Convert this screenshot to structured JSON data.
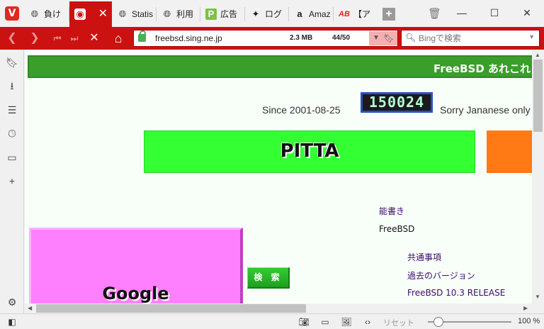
{
  "browser": {
    "tabs": [
      {
        "label": "負け",
        "icon": "globe"
      },
      {
        "label": "",
        "icon": "vivaldi-red"
      },
      {
        "label": "Statis",
        "icon": "globe"
      },
      {
        "label": "利用",
        "icon": "globe"
      },
      {
        "label": "広告",
        "icon": "p-green"
      },
      {
        "label": "ログ",
        "icon": "star-black"
      },
      {
        "label": "Amaz",
        "icon": "amazon-a"
      },
      {
        "label": "【ア",
        "icon": "ab-red"
      }
    ],
    "active_tab_index": 1,
    "url": "freebsd.sing.ne.jp",
    "page_size": "2.3 MB",
    "resource_count": "44/50",
    "search_placeholder": "Bingで検索"
  },
  "page": {
    "banner_text": "FreeBSD あれこれ",
    "since_text": "Since 2001-08-25",
    "counter_value": "150024",
    "sorry_text": "Sorry  Jananese only",
    "pitta_label": "PITTA",
    "google_label": "Google",
    "search_button_label": "検 索",
    "links": [
      {
        "label": "能書き"
      },
      {
        "label": "FreeBSD"
      },
      {
        "label": "共通事項"
      },
      {
        "label": "過去のバージョン"
      },
      {
        "label": "FreeBSD 10.3 RELEASE"
      }
    ]
  },
  "statusbar": {
    "reset_label": "リセット",
    "zoom": "100 %",
    "zoom_fraction": 0.1
  },
  "colors": {
    "accent": "#cc1111",
    "banner": "#3a9e2a",
    "pitta": "#33ff33",
    "google": "#ff80ff",
    "orange": "#ff7a14"
  }
}
